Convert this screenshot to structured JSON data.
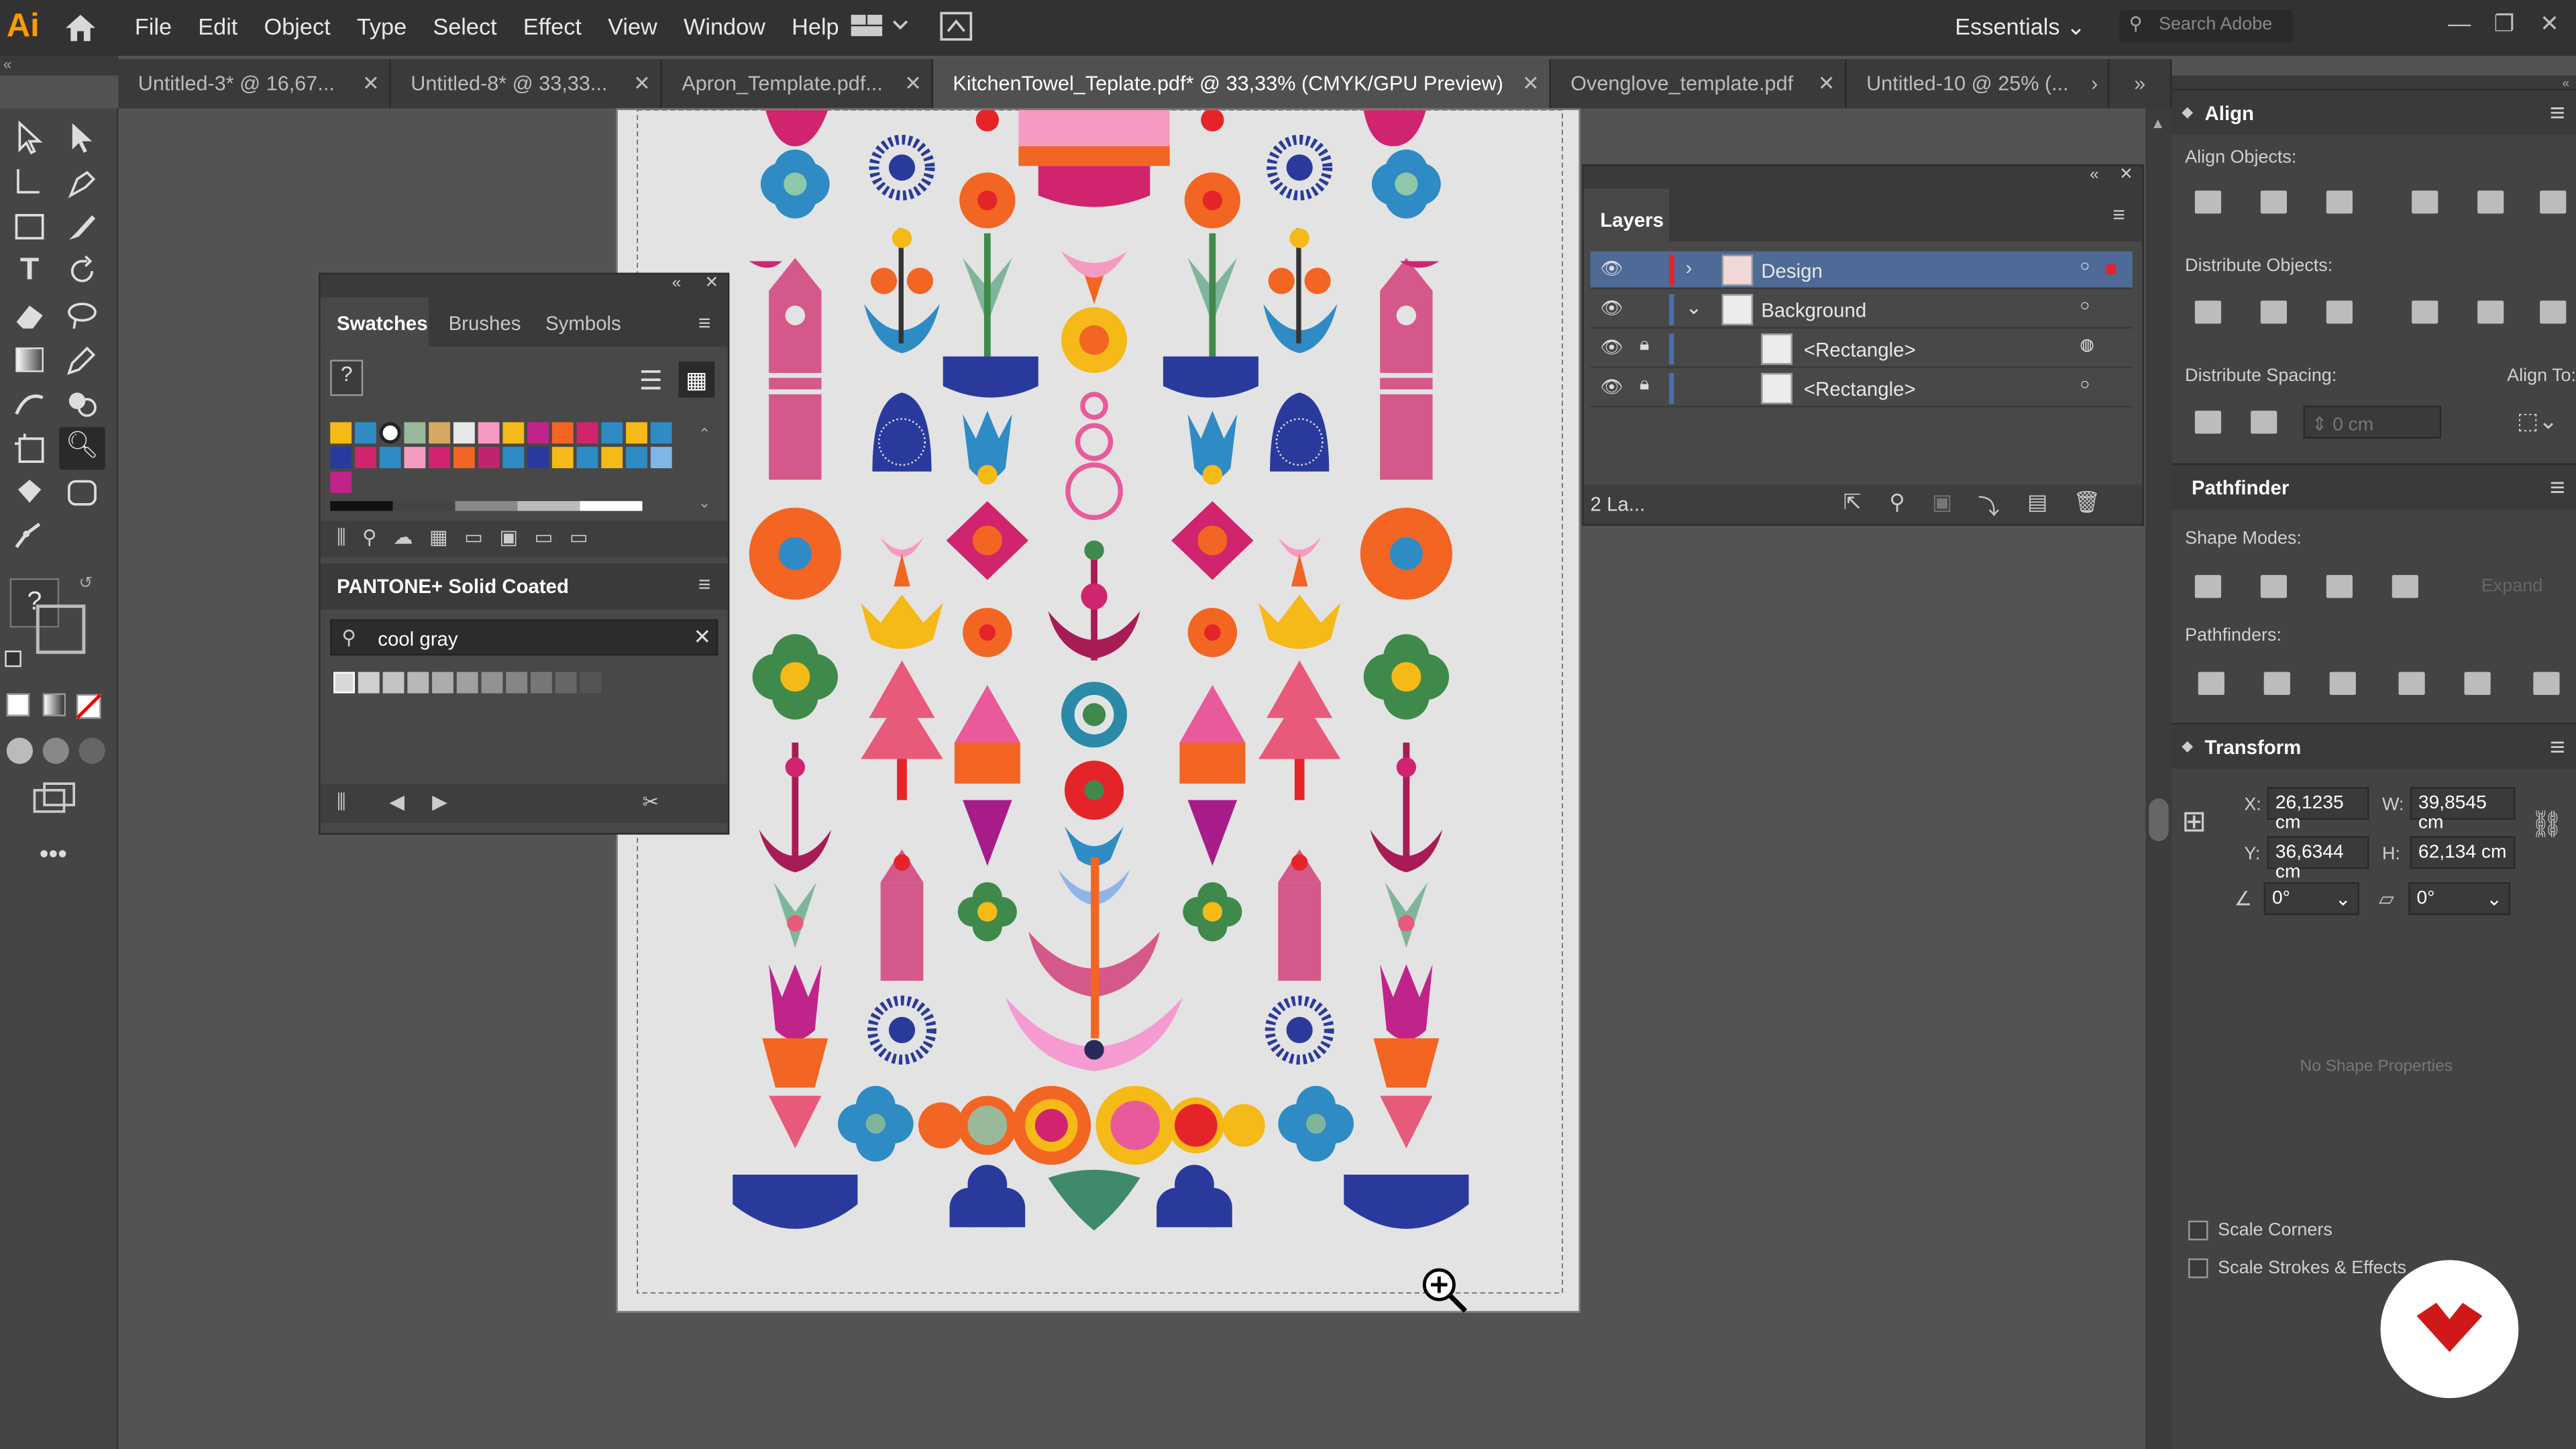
{
  "app": {
    "logo": "Ai",
    "menu": [
      "File",
      "Edit",
      "Object",
      "Type",
      "Select",
      "Effect",
      "View",
      "Window",
      "Help"
    ],
    "workspace": "Essentials",
    "search_placeholder": "Search Adobe"
  },
  "tabs": [
    {
      "label": "Untitled-3* @ 16,67...",
      "active": false
    },
    {
      "label": "Untitled-8* @ 33,33...",
      "active": false
    },
    {
      "label": "Apron_Template.pdf...",
      "active": false
    },
    {
      "label": "KitchenTowel_Teplate.pdf* @ 33,33% (CMYK/GPU Preview)",
      "active": true
    },
    {
      "label": "Ovenglove_template.pdf",
      "active": false
    },
    {
      "label": "Untitled-10 @ 25% (...",
      "active": false
    }
  ],
  "swatches_panel": {
    "tabs": [
      "Swatches",
      "Brushes",
      "Symbols"
    ],
    "pantone_title": "PANTONE+ Solid Coated",
    "search_value": "cool gray"
  },
  "layers_panel": {
    "title": "Layers",
    "rows": [
      {
        "name": "Design",
        "selected": true
      },
      {
        "name": "Background",
        "selected": false
      },
      {
        "name": "<Rectangle>",
        "selected": false
      },
      {
        "name": "<Rectangle>",
        "selected": false
      }
    ],
    "footer": "2 La..."
  },
  "align_panel": {
    "title": "Align",
    "align_objects": "Align Objects:",
    "distribute_objects": "Distribute Objects:",
    "distribute_spacing": "Distribute Spacing:",
    "align_to": "Align To:",
    "spacing_value": "0 cm"
  },
  "pathfinder_panel": {
    "title": "Pathfinder",
    "shape_modes": "Shape Modes:",
    "pathfinders": "Pathfinders:",
    "expand": "Expand"
  },
  "transform_panel": {
    "title": "Transform",
    "x_label": "X:",
    "x": "26,1235 cm",
    "y_label": "Y:",
    "y": "36,6344 cm",
    "w_label": "W:",
    "w": "39,8545 cm",
    "h_label": "H:",
    "h": "62,134 cm",
    "rotate": "0°",
    "shear": "0°",
    "no_shape": "No Shape Properties",
    "scale_corners": "Scale Corners",
    "scale_strokes": "Scale Strokes & Effects"
  },
  "colors": {
    "accent": "#4b6ea8",
    "orange": "#ff9a00",
    "pink": "#d54f8a",
    "navy": "#2a3a9c",
    "red": "#e5242a",
    "teal": "#2f8bc4",
    "green": "#3f8a4a",
    "yellow": "#f5b918"
  }
}
